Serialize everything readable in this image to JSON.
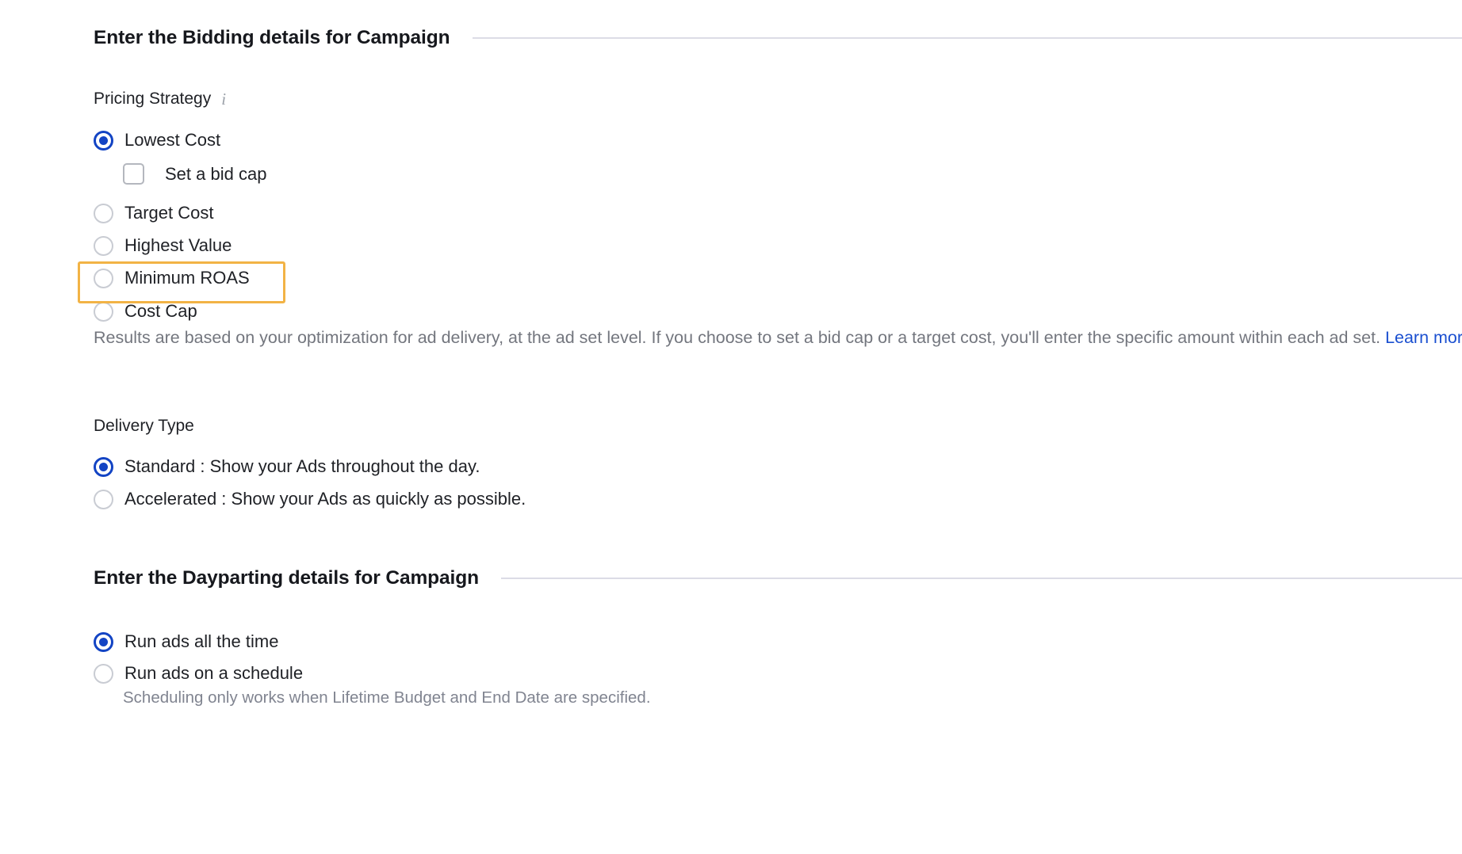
{
  "bidding_section": {
    "title": "Enter the Bidding details for Campaign",
    "pricing_strategy": {
      "label": "Pricing Strategy",
      "info_icon": "info-italic-i-icon",
      "options": [
        {
          "label": "Lowest Cost",
          "selected": true
        },
        {
          "label": "Target Cost",
          "selected": false
        },
        {
          "label": "Highest Value",
          "selected": false
        },
        {
          "label": "Minimum ROAS",
          "selected": false,
          "highlighted": true
        },
        {
          "label": "Cost Cap",
          "selected": false
        }
      ],
      "bid_cap_checkbox": {
        "label": "Set a bid cap",
        "checked": false
      },
      "help_text": "Results are based on your optimization for ad delivery, at the ad set level. If you choose to set a bid cap or a target cost, you'll enter the specific amount within each ad set.",
      "help_link": "Learn more."
    },
    "delivery_type": {
      "label": "Delivery Type",
      "options": [
        {
          "label": "Standard : Show your Ads throughout the day.",
          "selected": true
        },
        {
          "label": "Accelerated : Show your Ads as quickly as possible.",
          "selected": false
        }
      ]
    }
  },
  "dayparting_section": {
    "title": "Enter the Dayparting details for Campaign",
    "options": [
      {
        "label": "Run ads all the time",
        "selected": true
      },
      {
        "label": "Run ads on a schedule",
        "selected": false
      }
    ],
    "note": "Scheduling only works when Lifetime Budget and End Date are specified."
  },
  "colors": {
    "accent_blue": "#1344c4",
    "link_blue": "#1a4fd0",
    "highlight_orange": "#f2b345",
    "divider_gray": "#dcdce6",
    "muted_text": "#73767e"
  }
}
